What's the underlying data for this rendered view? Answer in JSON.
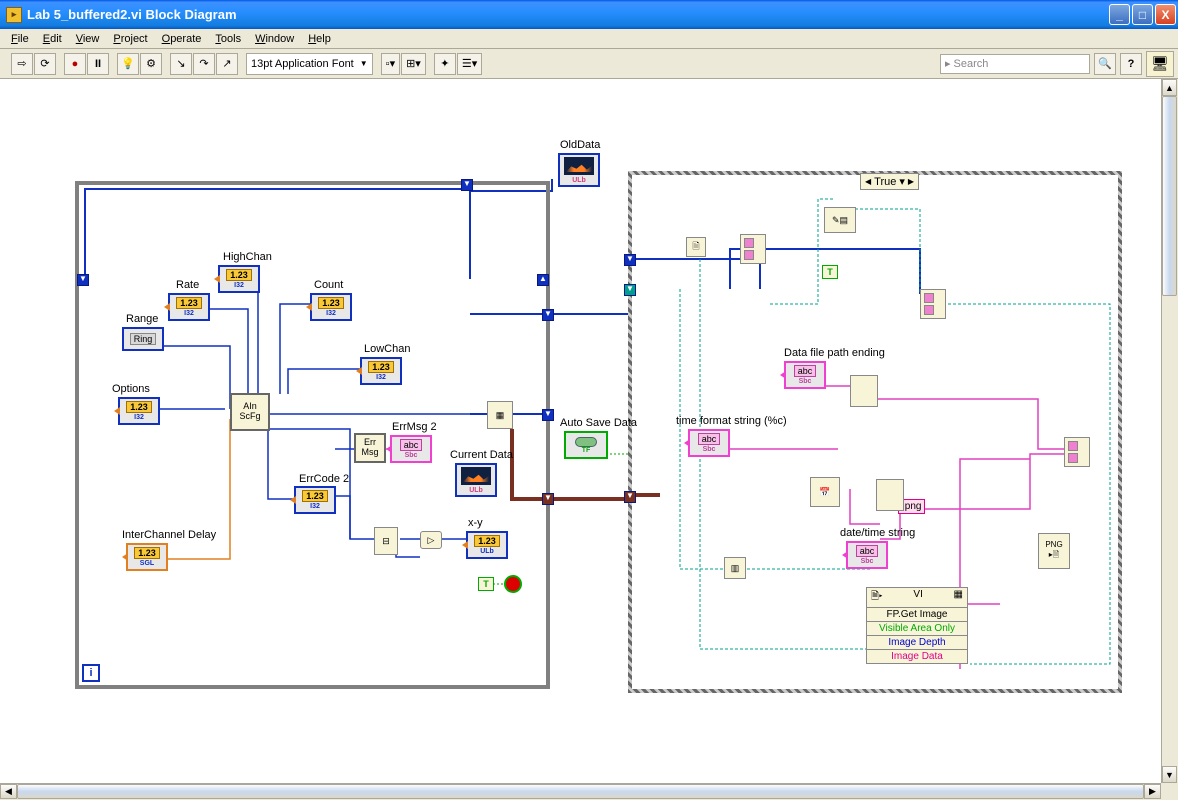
{
  "window": {
    "title": "Lab 5_buffered2.vi Block Diagram",
    "icon_letter": "▸"
  },
  "menu": {
    "file": "File",
    "edit": "Edit",
    "view": "View",
    "project": "Project",
    "operate": "Operate",
    "tools": "Tools",
    "window": "Window",
    "help": "Help"
  },
  "toolbar": {
    "font": "13pt Application Font",
    "search_placeholder": "Search"
  },
  "case": {
    "selector": "True"
  },
  "labels": {
    "old_data": "OldData",
    "high_chan": "HighChan",
    "rate": "Rate",
    "count": "Count",
    "range": "Range",
    "low_chan": "LowChan",
    "options": "Options",
    "ain_scfg": "AIn\nScFg",
    "err_msg": "Err\nMsg",
    "errmsg2": "ErrMsg 2",
    "errcode2": "ErrCode 2",
    "current_data": "Current Data",
    "interchan": "InterChannel Delay",
    "xy": "x-y",
    "auto_save": "Auto Save Data",
    "data_file_path": "Data file path ending",
    "time_fmt": "time format string (%c)",
    "date_time": "date/time string",
    "png_ext": ".png",
    "png_label": "PNG"
  },
  "control_text": {
    "dbl": "1.23",
    "dbl_sub": "I32",
    "dbl_sub_sgl": "SGL",
    "ring": "Ring",
    "abc": "abc",
    "abc_sub": "Sbc",
    "ulb": "ULb"
  },
  "prop_node": {
    "header": "VI",
    "r1": "FP.Get Image",
    "r2": "Visible Area Only",
    "r3": "Image Depth",
    "r4": "Image Data"
  },
  "const": {
    "true": "T",
    "iter": "i"
  }
}
